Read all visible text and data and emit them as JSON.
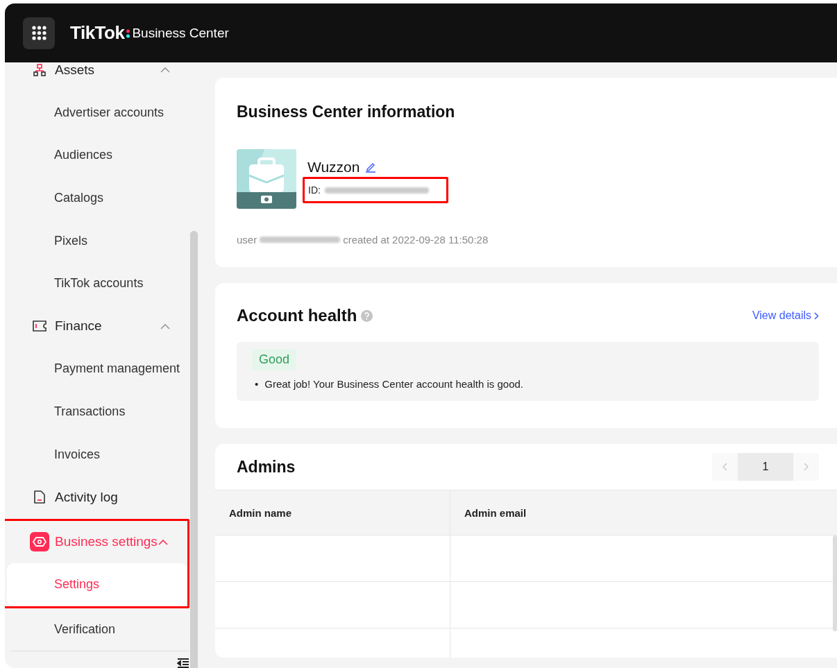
{
  "header": {
    "logo_text": "TikTok",
    "product": "Business Center"
  },
  "sidebar": {
    "items": [
      {
        "kind": "group",
        "label": "Assets",
        "expanded": true,
        "selected": false,
        "highlighted": false,
        "children": [
          {
            "label": "Advertiser accounts",
            "selected": false,
            "highlighted": false
          },
          {
            "label": "Audiences",
            "selected": false,
            "highlighted": false
          },
          {
            "label": "Catalogs",
            "selected": false,
            "highlighted": false
          },
          {
            "label": "Pixels",
            "selected": false,
            "highlighted": false
          },
          {
            "label": "TikTok accounts",
            "selected": false,
            "highlighted": false
          }
        ]
      },
      {
        "kind": "group",
        "label": "Finance",
        "expanded": true,
        "selected": false,
        "highlighted": false,
        "children": [
          {
            "label": "Payment management",
            "selected": false,
            "highlighted": false
          },
          {
            "label": "Transactions",
            "selected": false,
            "highlighted": false
          },
          {
            "label": "Invoices",
            "selected": false,
            "highlighted": false
          }
        ]
      },
      {
        "kind": "link",
        "label": "Activity log",
        "selected": false,
        "highlighted": false
      },
      {
        "kind": "group",
        "label": "Business settings",
        "expanded": true,
        "selected": true,
        "highlighted": true,
        "children": [
          {
            "label": "Settings",
            "selected": true,
            "highlighted": true
          },
          {
            "label": "Verification",
            "selected": false,
            "highlighted": false
          }
        ]
      }
    ]
  },
  "info": {
    "title": "Business Center information",
    "name": "Wuzzon",
    "id_label": "ID:",
    "id_highlighted": true,
    "creator_prefix": "user",
    "created": "created at 2022-09-28 11:50:28"
  },
  "health": {
    "title": "Account health",
    "link": "View details",
    "status": "Good",
    "notes": [
      {
        "marker": "•",
        "text": "Great job! Your Business Center account health is good."
      }
    ]
  },
  "admins": {
    "title": "Admins",
    "pagination": {
      "prev_disabled": true,
      "next_disabled": true,
      "pages": [
        {
          "label": "1",
          "selected": true
        }
      ]
    },
    "columns": [
      "Admin name",
      "Admin email"
    ]
  }
}
